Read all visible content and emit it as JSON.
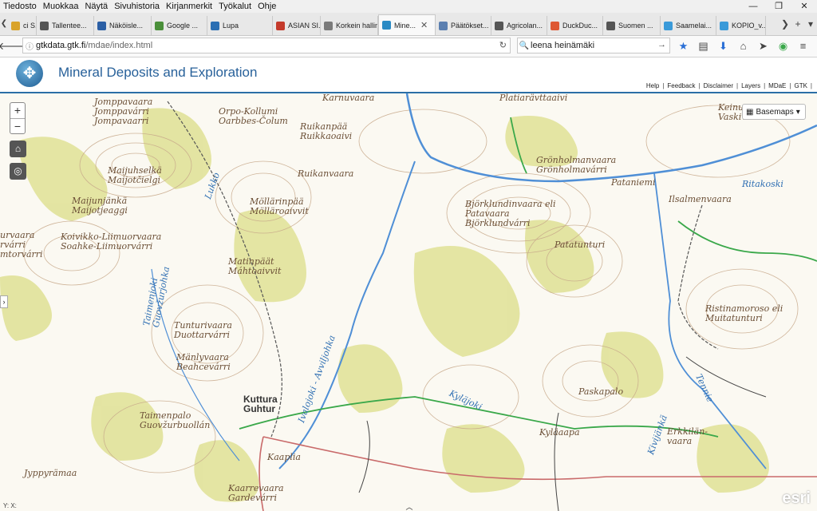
{
  "menu": [
    "Tiedosto",
    "Muokkaa",
    "Näytä",
    "Sivuhistoria",
    "Kirjanmerkit",
    "Työkalut",
    "Ohje"
  ],
  "window_controls": [
    "—",
    "❐",
    "✕"
  ],
  "tabs": [
    {
      "label": "ci S...",
      "color": "#d9a32b"
    },
    {
      "label": "Tallentee...",
      "color": "#555555"
    },
    {
      "label": "Näköisle...",
      "color": "#2b5fa5"
    },
    {
      "label": "Google ...",
      "color": "#4a8f3a"
    },
    {
      "label": "Lupa",
      "color": "#2b6fb3"
    },
    {
      "label": "ASIAN SI...",
      "color": "#c43a2b"
    },
    {
      "label": "Korkein hallin...",
      "color": "#7a7a7a"
    },
    {
      "label": "Mine...",
      "color": "#2a8ac4",
      "active": true
    },
    {
      "label": "Päätökset...",
      "color": "#5b7fb0"
    },
    {
      "label": "Agricolan...",
      "color": "#555555"
    },
    {
      "label": "DuckDuc...",
      "color": "#de5833"
    },
    {
      "label": "Suomen ...",
      "color": "#555555"
    },
    {
      "label": "Saamelai...",
      "color": "#3a9ad9"
    },
    {
      "label": "KOPIO_v...",
      "color": "#3a9ad9"
    }
  ],
  "url": {
    "host": "gtkdata.gtk.fi",
    "path": "/mdae/index.html"
  },
  "search": {
    "value": "leena heinämäki"
  },
  "app": {
    "title": "Mineral Deposits and Exploration",
    "links": [
      "Help",
      "Feedback",
      "Disclaimer",
      "Layers",
      "MDaE",
      "GTK"
    ]
  },
  "map": {
    "basemaps_label": "Basemaps",
    "coords_label": "Y:  X:",
    "attribution": "esri",
    "colors": {
      "river": "#4f8fd6",
      "forest": "#e1e29a",
      "contour": "#c7a88a",
      "road": "#c96a6a",
      "trail": "#3aa84a"
    },
    "labels": {
      "l1": "Jomppavaara\nJomppavárri\nJompavaarri",
      "l2": "Orpo-Kollumi\nOarbbes-Čolum",
      "l3": "Ruikanpää\nRuikkaoaivi",
      "l4": "Ruikanvaara",
      "l5": "Maijuhselkä\nMaijotčielgi",
      "l6": "Maijunjänkä\nMaijotjeaggi",
      "l7": "Koivikko-Liimuorvaara\nSoahke-Liimuorvárri",
      "l8": "Möllärinpää\nMölläroaivvit",
      "l9": "Matinpäät\nMáhtoaivvit",
      "l10": "Tunturivaara\nDuottarvárri",
      "l11": "Mänlyvaara\nBeahcevárri",
      "l12": "Kuttura\nGuhtur",
      "l13": "Taimenpalo\nGuovžurbuollán",
      "l14": "Kaaplia",
      "l15": "Kaarrevaara\nGardevárri",
      "l16": "Jyppyrämaa",
      "l17": "Grönholmanvaara\nGrönholmavárri",
      "l18": "Björklundinvaara eli\nPatavaara\nBjörklundvárri",
      "l19": "Pataniemi",
      "l20": "Ilsalmenvaara",
      "l21": "Patatunturi",
      "l22": "Ristinamoroso eli\nMuitatunturi",
      "l23": "Paskapalo",
      "l24": "Kyläaapa",
      "l25": "Erkkilän-\nvaara",
      "l26": "Kyläjoki",
      "l27": "Ivalojoki - Avviljohka",
      "l28": "Taimenjoki\nGuovžurjohka",
      "l29": "Platiarävttaaivi",
      "l30": "Keinu\nVaskiv",
      "l31": "Karnuvaara",
      "l32": "Ritakoski",
      "l33": "Tennie",
      "l34": "Kivijänkä",
      "l35": "urvaara\nrvárri\nmtorvárri",
      "l36": "Lukko"
    }
  }
}
